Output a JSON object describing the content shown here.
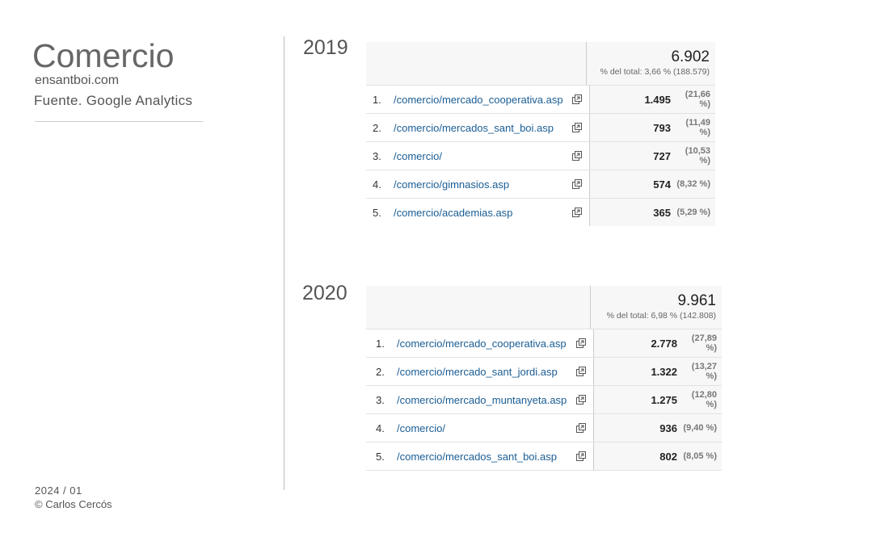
{
  "header": {
    "title": "Comercio",
    "site": "ensantboi.com",
    "source": "Fuente. Google Analytics"
  },
  "footer": {
    "date": "2024 / 01",
    "copyright": "© Carlos Cercós"
  },
  "tables": [
    {
      "year": "2019",
      "total": "6.902",
      "total_sub": "% del total: 3,66 % (188.579)",
      "rows": [
        {
          "index": "1.",
          "page": "/comercio/mercado_cooperativa.asp",
          "value": "1.495",
          "pct": "(21,66 %)"
        },
        {
          "index": "2.",
          "page": "/comercio/mercados_sant_boi.asp",
          "value": "793",
          "pct": "(11,49 %)"
        },
        {
          "index": "3.",
          "page": "/comercio/",
          "value": "727",
          "pct": "(10,53 %)"
        },
        {
          "index": "4.",
          "page": "/comercio/gimnasios.asp",
          "value": "574",
          "pct": "(8,32 %)"
        },
        {
          "index": "5.",
          "page": "/comercio/academias.asp",
          "value": "365",
          "pct": "(5,29 %)"
        }
      ]
    },
    {
      "year": "2020",
      "total": "9.961",
      "total_sub": "% del total: 6,98 % (142.808)",
      "rows": [
        {
          "index": "1.",
          "page": "/comercio/mercado_cooperativa.asp",
          "value": "2.778",
          "pct": "(27,89 %)"
        },
        {
          "index": "2.",
          "page": "/comercio/mercado_sant_jordi.asp",
          "value": "1.322",
          "pct": "(13,27 %)"
        },
        {
          "index": "3.",
          "page": "/comercio/mercado_muntanyeta.asp",
          "value": "1.275",
          "pct": "(12,80 %)"
        },
        {
          "index": "4.",
          "page": "/comercio/",
          "value": "936",
          "pct": "(9,40 %)"
        },
        {
          "index": "5.",
          "page": "/comercio/mercados_sant_boi.asp",
          "value": "802",
          "pct": "(8,05 %)"
        }
      ]
    }
  ]
}
